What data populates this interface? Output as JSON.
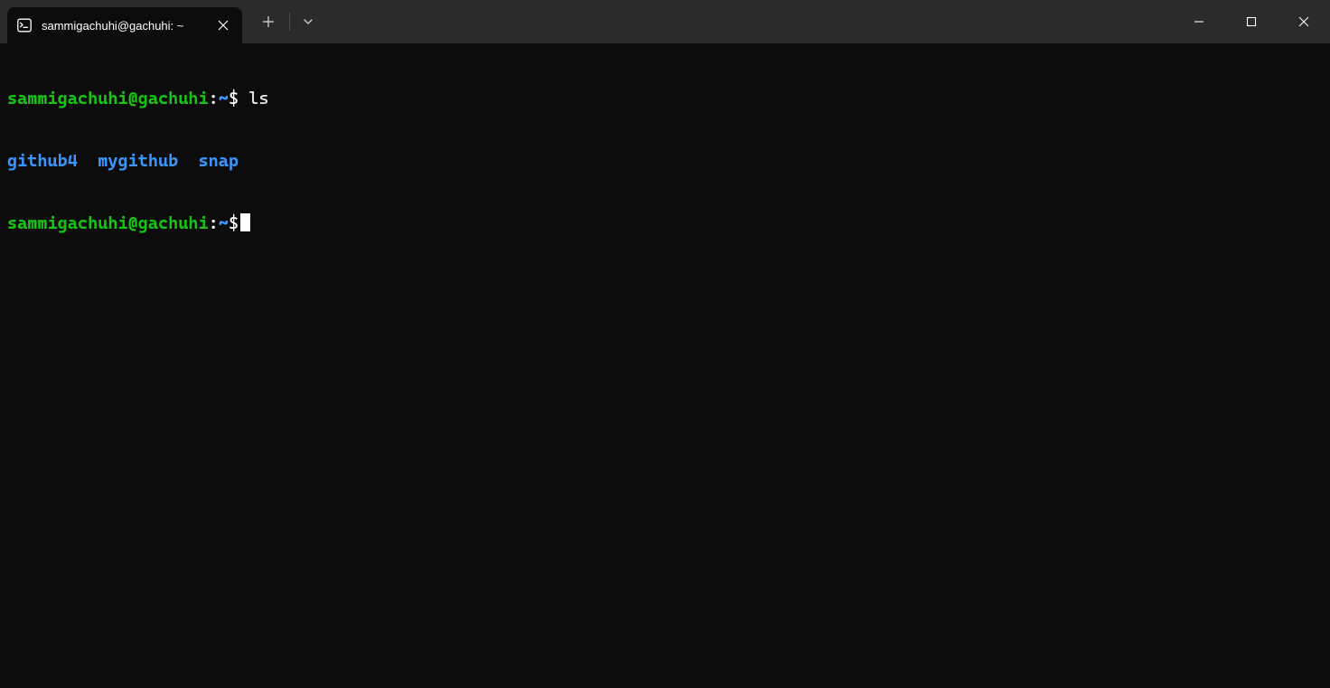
{
  "tab": {
    "title": "sammigachuhi@gachuhi: ~"
  },
  "prompt": {
    "user_host": "sammigachuhi@gachuhi",
    "colon": ":",
    "path": "~",
    "dollar": "$"
  },
  "session": {
    "line1_command": " ls",
    "dirs": [
      "github4",
      "mygithub",
      "snap"
    ],
    "sep": "  "
  }
}
